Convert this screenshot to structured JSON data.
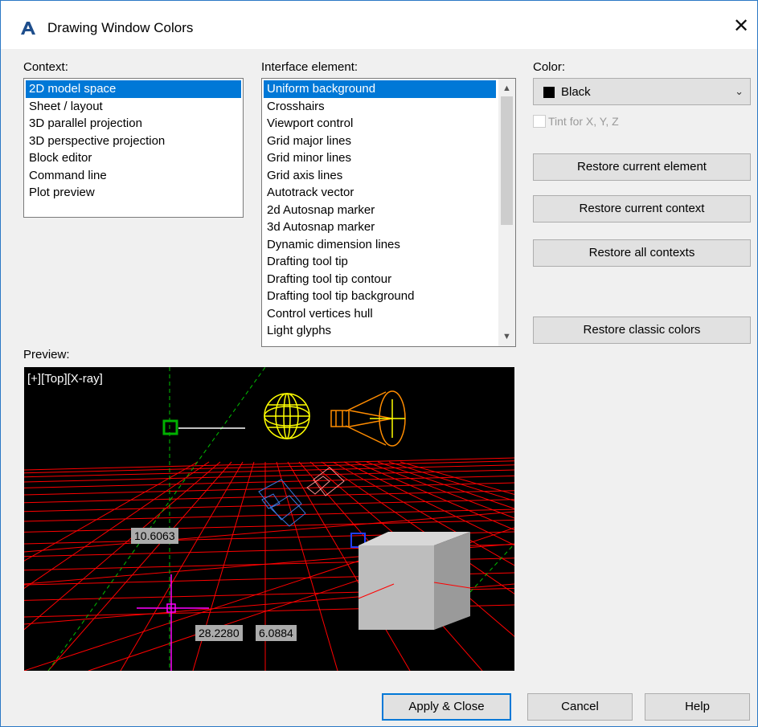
{
  "window": {
    "title": "Drawing Window Colors",
    "close_glyph": "✕"
  },
  "context": {
    "label": "Context:",
    "items": [
      "2D model space",
      "Sheet / layout",
      "3D parallel projection",
      "3D perspective projection",
      "Block editor",
      "Command line",
      "Plot preview"
    ],
    "selected_index": 0
  },
  "interface_element": {
    "label": "Interface element:",
    "items": [
      "Uniform background",
      "Crosshairs",
      "Viewport control",
      "Grid major lines",
      "Grid minor lines",
      "Grid axis lines",
      "Autotrack vector",
      "2d Autosnap marker",
      "3d Autosnap marker",
      "Dynamic dimension lines",
      "Drafting tool tip",
      "Drafting tool tip contour",
      "Drafting tool tip background",
      "Control vertices hull",
      "Light glyphs"
    ],
    "selected_index": 0
  },
  "color": {
    "label": "Color:",
    "selected": "Black",
    "swatch": "#000000",
    "tint_label": "Tint for X, Y, Z",
    "tint_checked": false
  },
  "buttons": {
    "restore_element": "Restore current element",
    "restore_context": "Restore current context",
    "restore_all": "Restore all contexts",
    "restore_classic": "Restore classic colors",
    "apply": "Apply & Close",
    "cancel": "Cancel",
    "help": "Help"
  },
  "preview": {
    "label": "Preview:",
    "viewport_label": "[+][Top][X-ray]",
    "dim_1": "10.6063",
    "dim_2": "28.2280",
    "dim_3": "6.0884",
    "colors": {
      "grid": "#ff0000",
      "background": "#000000",
      "autosnap": "#00a000",
      "light": "#ffff00",
      "camera": "#ff8c00",
      "crosshair": "#ff00ff",
      "solid": "#c0c0c0"
    }
  },
  "accent": "#0078d7"
}
